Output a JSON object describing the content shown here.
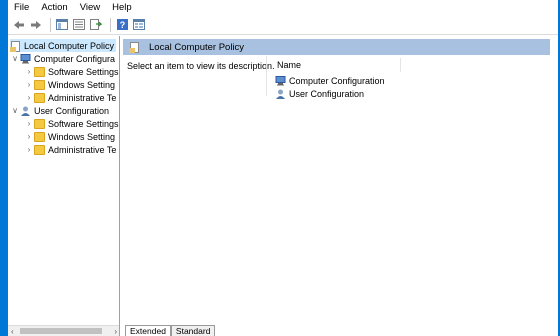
{
  "menu": [
    "File",
    "Action",
    "View",
    "Help"
  ],
  "toolbar": {
    "icons": [
      "back-arrow-icon",
      "forward-arrow-icon",
      "show-hide-tree-icon",
      "properties-icon",
      "export-list-icon",
      "help-icon",
      "console-icon"
    ]
  },
  "tree": {
    "root_label": "Local Computer Policy",
    "computer_config": {
      "label": "Computer Configura",
      "children": [
        "Software Settings",
        "Windows Setting",
        "Administrative Te"
      ]
    },
    "user_config": {
      "label": "User Configuration",
      "children": [
        "Software Settings",
        "Windows Setting",
        "Administrative Te"
      ]
    }
  },
  "right": {
    "header_title": "Local Computer Policy",
    "description": "Select an item to view its description.",
    "column_name": "Name",
    "items": [
      "Computer Configuration",
      "User Configuration"
    ]
  },
  "tabs": {
    "extended": "Extended",
    "standard": "Standard"
  },
  "colors": {
    "frame": "#0078d7",
    "header": "#a8c1e0",
    "selection": "#cce8ff"
  }
}
